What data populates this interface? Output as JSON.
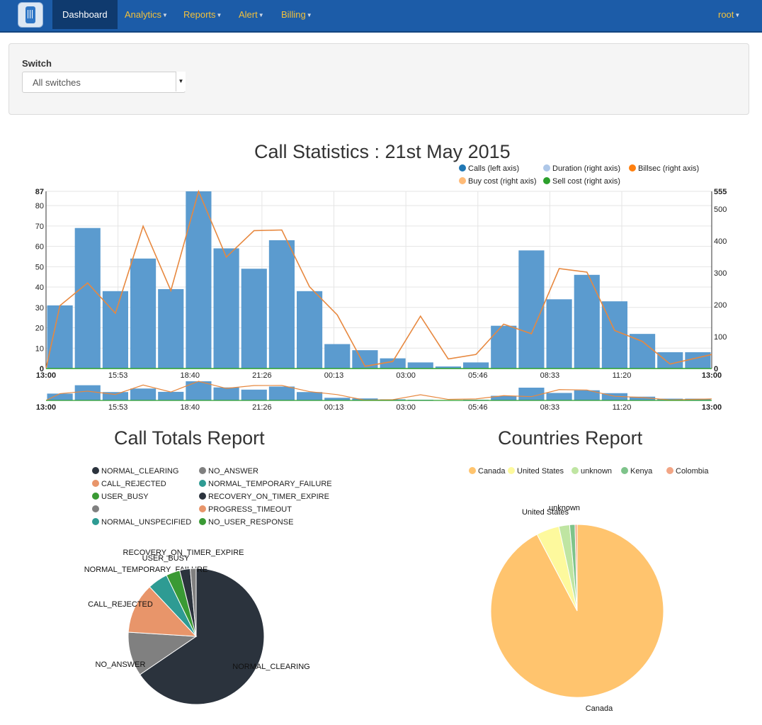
{
  "nav": {
    "items": [
      {
        "label": "Dashboard",
        "active": true,
        "dropdown": false
      },
      {
        "label": "Analytics",
        "active": false,
        "dropdown": true
      },
      {
        "label": "Reports",
        "active": false,
        "dropdown": true
      },
      {
        "label": "Alert",
        "active": false,
        "dropdown": true
      },
      {
        "label": "Billing",
        "active": false,
        "dropdown": true
      }
    ],
    "user": "root"
  },
  "switch": {
    "label": "Switch",
    "value": "All switches"
  },
  "call_stats": {
    "title": "Call Statistics : 21st May 2015",
    "legend": [
      {
        "label": "Calls (left axis)",
        "color": "#1f77b4"
      },
      {
        "label": "Duration (right axis)",
        "color": "#aec7e8"
      },
      {
        "label": "Billsec (right axis)",
        "color": "#ff7f0e"
      },
      {
        "label": "Buy cost (right axis)",
        "color": "#ffbb78"
      },
      {
        "label": "Sell cost (right axis)",
        "color": "#2ca02c"
      }
    ]
  },
  "call_totals": {
    "title": "Call Totals Report",
    "legend": [
      {
        "label": "NORMAL_CLEARING",
        "color": "#2b333d"
      },
      {
        "label": "NO_ANSWER",
        "color": "#808080"
      },
      {
        "label": "CALL_REJECTED",
        "color": "#e8956a"
      },
      {
        "label": "NORMAL_TEMPORARY_FAILURE",
        "color": "#2e9b93"
      },
      {
        "label": "USER_BUSY",
        "color": "#3a9a34"
      },
      {
        "label": "RECOVERY_ON_TIMER_EXPIRE",
        "color": "#2b333d"
      },
      {
        "label": "",
        "color": "#808080"
      },
      {
        "label": "PROGRESS_TIMEOUT",
        "color": "#e8956a"
      },
      {
        "label": "NORMAL_UNSPECIFIED",
        "color": "#2e9b93"
      },
      {
        "label": "NO_USER_RESPONSE",
        "color": "#3a9a34"
      }
    ]
  },
  "countries": {
    "title": "Countries Report",
    "legend": [
      {
        "label": "Canada",
        "color": "#ffc46e"
      },
      {
        "label": "United States",
        "color": "#fdf99d"
      },
      {
        "label": "unknown",
        "color": "#bfe5a2"
      },
      {
        "label": "Kenya",
        "color": "#7ec38a"
      },
      {
        "label": "Colombia",
        "color": "#f2a585"
      }
    ]
  },
  "chart_data": [
    {
      "type": "bar",
      "title": "Call Statistics : 21st May 2015",
      "x_tick_labels": [
        "13:00",
        "15:53",
        "18:40",
        "21:26",
        "00:13",
        "03:00",
        "05:46",
        "08:33",
        "11:20",
        "13:00"
      ],
      "left_axis": {
        "ylim": [
          0,
          87
        ],
        "ticks": [
          0,
          10,
          20,
          30,
          40,
          50,
          60,
          70,
          80,
          87
        ]
      },
      "right_axis": {
        "ylim": [
          0,
          555
        ],
        "ticks": [
          0,
          100,
          200,
          300,
          400,
          500,
          555
        ]
      },
      "series": [
        {
          "name": "Calls (left axis)",
          "type": "bar",
          "axis": "left",
          "values": [
            31,
            69,
            38,
            54,
            39,
            87,
            59,
            49,
            63,
            38,
            12,
            9,
            5,
            3,
            1,
            3,
            21,
            58,
            34,
            46,
            33,
            17,
            8,
            8
          ]
        },
        {
          "name": "Billsec (right axis)",
          "type": "line",
          "axis": "right",
          "points": [
            [
              0,
              0
            ],
            [
              0.5,
              197
            ],
            [
              1.5,
              268
            ],
            [
              2.5,
              173
            ],
            [
              3.5,
              446
            ],
            [
              4.5,
              244
            ],
            [
              5.5,
              555
            ],
            [
              6.5,
              349
            ],
            [
              7.5,
              432
            ],
            [
              8.5,
              434
            ],
            [
              9.5,
              256
            ],
            [
              10.5,
              168
            ],
            [
              11.5,
              7
            ],
            [
              12.5,
              22
            ],
            [
              13.5,
              164
            ],
            [
              14.5,
              30
            ],
            [
              15.5,
              44
            ],
            [
              16.5,
              139
            ],
            [
              17.5,
              109
            ],
            [
              18.5,
              313
            ],
            [
              19.5,
              302
            ],
            [
              20.5,
              119
            ],
            [
              21.5,
              85
            ],
            [
              22.5,
              14
            ],
            [
              24,
              44
            ]
          ]
        },
        {
          "name": "Sell cost (right axis)",
          "type": "line",
          "axis": "right",
          "points": [
            [
              0,
              0
            ],
            [
              24,
              0
            ]
          ]
        }
      ],
      "grid": true,
      "legend_position": "top-right"
    },
    {
      "type": "pie",
      "title": "Call Totals Report",
      "slices": [
        {
          "label": "NORMAL_CLEARING",
          "value": 65.5
        },
        {
          "label": "NO_ANSWER",
          "value": 10.5
        },
        {
          "label": "CALL_REJECTED",
          "value": 12
        },
        {
          "label": "NORMAL_TEMPORARY_FAILURE",
          "value": 4.8
        },
        {
          "label": "USER_BUSY",
          "value": 3.3
        },
        {
          "label": "RECOVERY_ON_TIMER_EXPIRE",
          "value": 2.5
        },
        {
          "label": "",
          "value": 1.4
        }
      ]
    },
    {
      "type": "pie",
      "title": "Countries Report",
      "slices": [
        {
          "label": "Canada",
          "value": 92.3
        },
        {
          "label": "United States",
          "value": 4.3
        },
        {
          "label": "unknown",
          "value": 2.0
        },
        {
          "label": "Kenya",
          "value": 1.0
        },
        {
          "label": "Colombia",
          "value": 0.4
        }
      ]
    }
  ]
}
